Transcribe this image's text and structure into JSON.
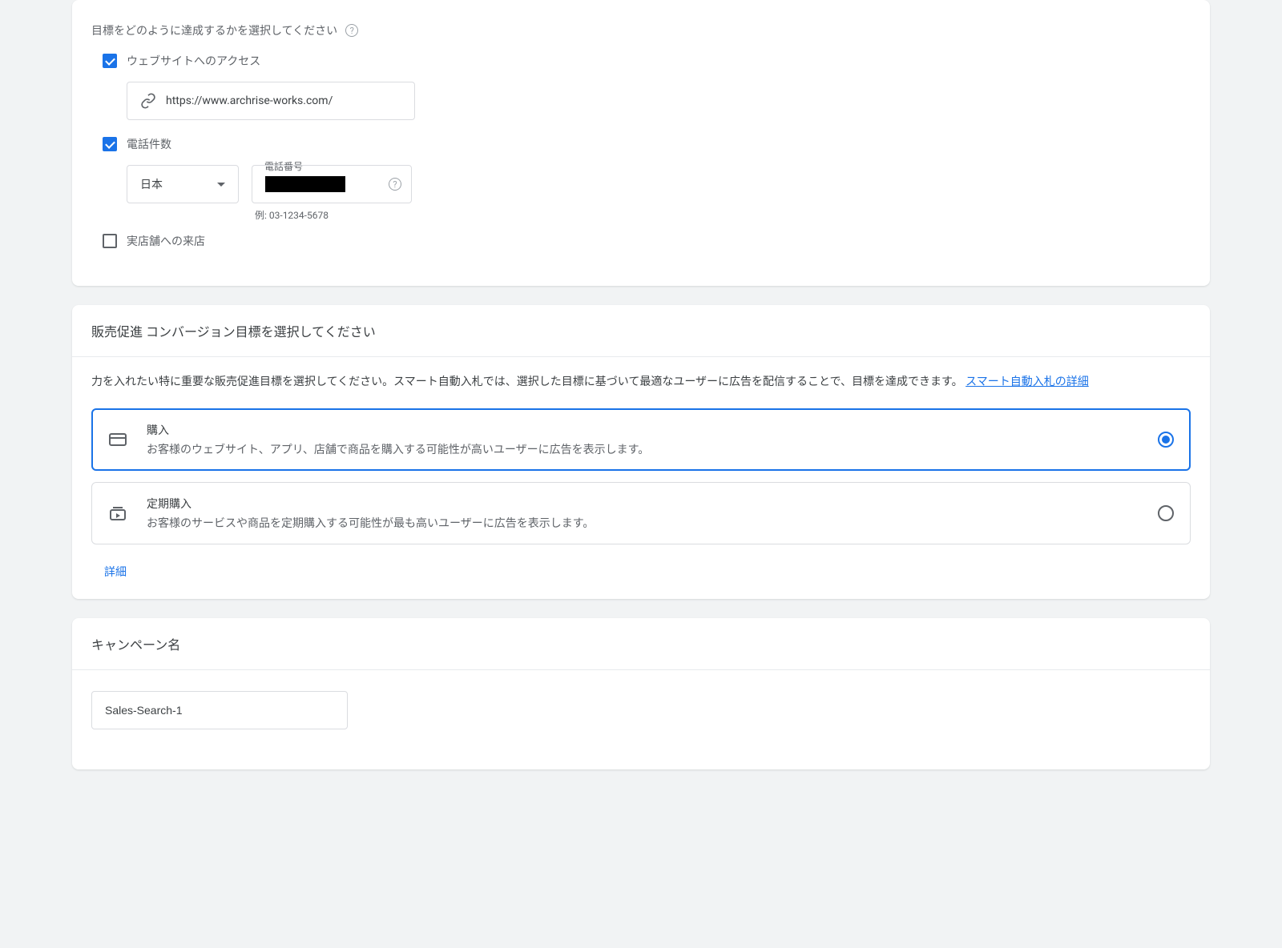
{
  "goals_card": {
    "title": "目標をどのように達成するかを選択してください",
    "website_access_label": "ウェブサイトへのアクセス",
    "website_url": "https://www.archrise-works.com/",
    "phone_calls_label": "電話件数",
    "country_label": "日本",
    "phone_floating_label": "電話番号",
    "phone_example": "例: 03-1234-5678",
    "store_visits_label": "実店舗への来店"
  },
  "conversion_card": {
    "header": "販売促進 コンバージョン目標を選択してください",
    "description_prefix": "力を入れたい特に重要な販売促進目標を選択してください。スマート自動入札では、選択した目標に基づいて最適なユーザーに広告を配信することで、目標を達成できます。 ",
    "smart_bidding_link": "スマート自動入札の詳細",
    "options": [
      {
        "title": "購入",
        "desc": "お客様のウェブサイト、アプリ、店舗で商品を購入する可能性が高いユーザーに広告を表示します。"
      },
      {
        "title": "定期購入",
        "desc": "お客様のサービスや商品を定期購入する可能性が最も高いユーザーに広告を表示します。"
      }
    ],
    "details_label": "詳細"
  },
  "campaign_card": {
    "header": "キャンペーン名",
    "value": "Sales-Search-1"
  }
}
